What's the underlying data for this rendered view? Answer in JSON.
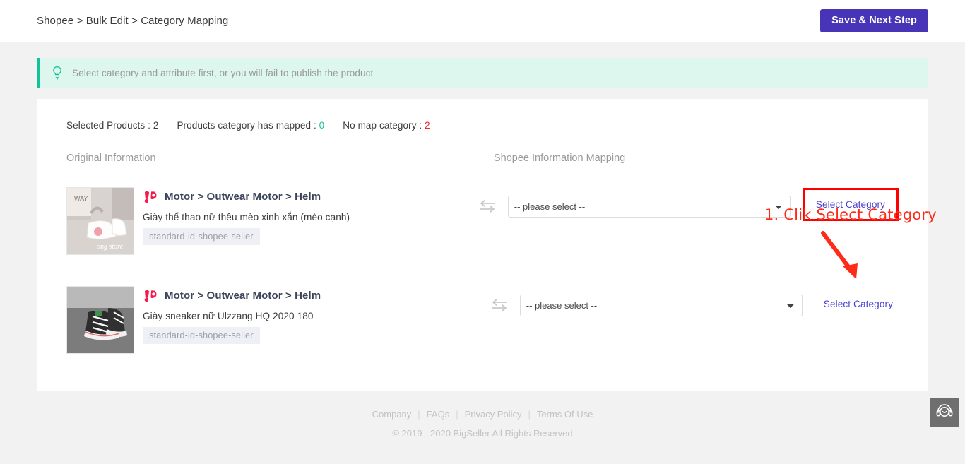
{
  "header": {
    "breadcrumb": "Shopee > Bulk Edit > Category Mapping",
    "save_label": "Save & Next Step"
  },
  "alert": {
    "icon": "lightbulb-icon",
    "text": "Select category and attribute first, or you will fail to publish the product"
  },
  "stats": {
    "selected_label": "Selected Products : ",
    "selected_value": "2",
    "mapped_label": "Products category has mapped : ",
    "mapped_value": "0",
    "nomap_label": "No map category : ",
    "nomap_value": "2"
  },
  "annotation": {
    "text": "1. Clik Select Category",
    "color": "#fe2b18"
  },
  "table": {
    "header_original": "Original Information",
    "header_mapping": "Shopee Information Mapping",
    "rows": [
      {
        "thumb_alt": "white-sneakers-photo",
        "platform_icon": "shopee-logo-icon",
        "category_path": "Motor > Outwear Motor > Helm",
        "product_title": "Giày thể thao nữ thêu mèo xinh xắn (mèo cạnh)",
        "tag": "standard-id-shopee-seller",
        "swap_icon": "exchange-arrows-icon",
        "select_value": "-- please select --",
        "select_link": "Select Category",
        "highlighted": true
      },
      {
        "thumb_alt": "black-canvas-sneakers-photo",
        "platform_icon": "shopee-logo-icon",
        "category_path": "Motor > Outwear Motor > Helm",
        "product_title": "Giày sneaker nữ Ulzzang HQ 2020 180",
        "tag": "standard-id-shopee-seller",
        "swap_icon": "exchange-arrows-icon",
        "select_value": "-- please select --",
        "select_link": "Select Category",
        "highlighted": false
      }
    ]
  },
  "footer": {
    "links": [
      "Company",
      "FAQs",
      "Privacy Policy",
      "Terms Of Use"
    ],
    "copyright": "© 2019 - 2020 BigSeller All Rights Reserved"
  },
  "chat": {
    "icon": "headset-support-icon"
  },
  "colors": {
    "accent": "#4834b6",
    "alert_bg": "#ddf7ef",
    "alert_border": "#13c296",
    "link": "#4a42cf",
    "danger": "#f5222d",
    "highlight_box": "#fe0000"
  }
}
